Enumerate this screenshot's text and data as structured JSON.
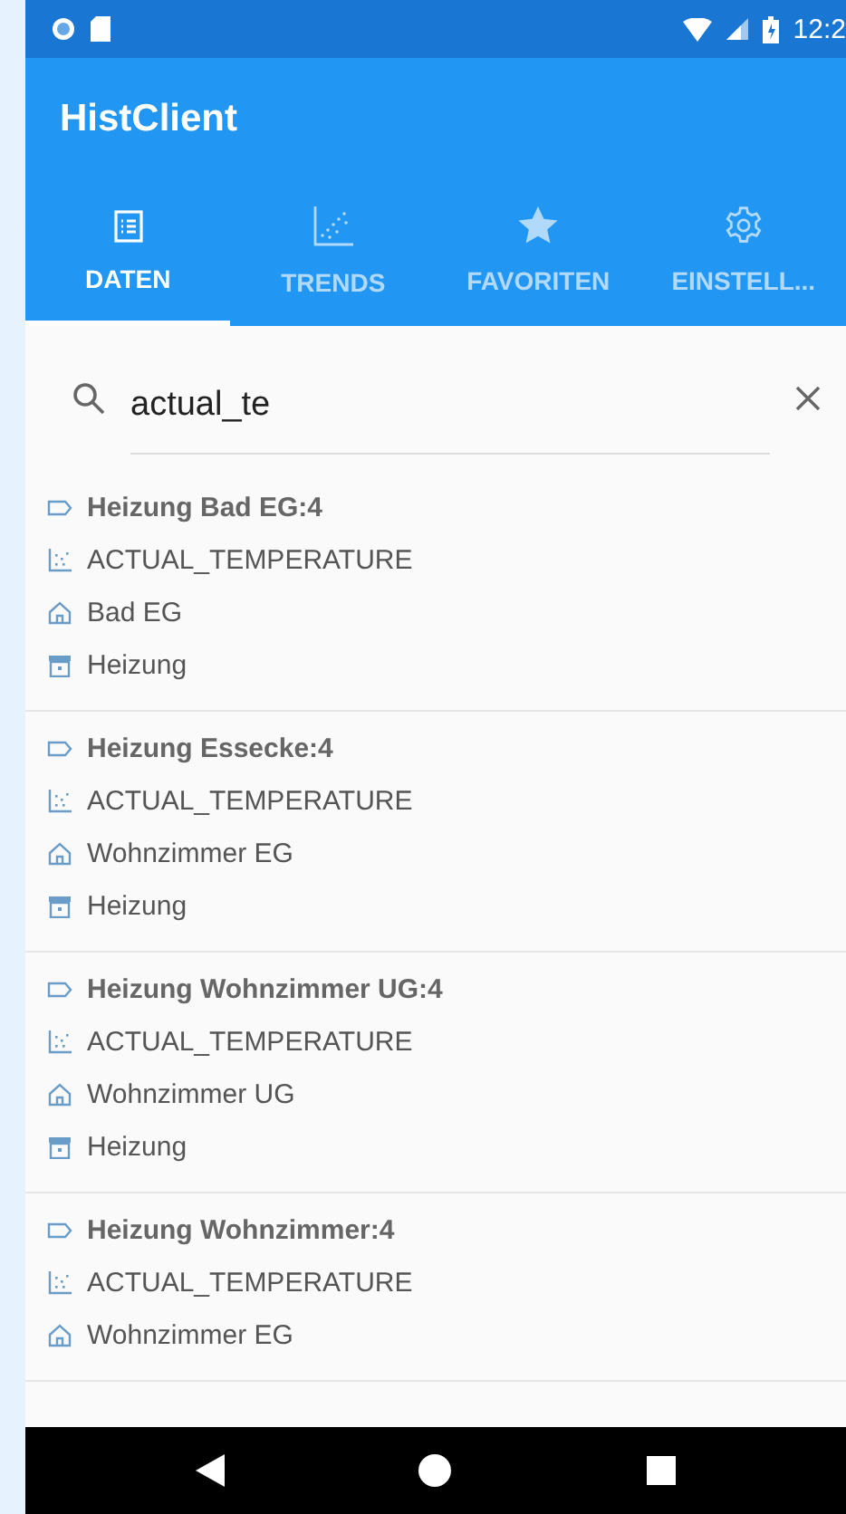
{
  "status_bar": {
    "time": "12:2"
  },
  "app_bar": {
    "title": "HistClient"
  },
  "tabs": [
    {
      "label": "DATEN",
      "kind": "list",
      "selected": true
    },
    {
      "label": "TRENDS",
      "kind": "chart",
      "selected": false
    },
    {
      "label": "FAVORITEN",
      "kind": "star",
      "selected": false
    },
    {
      "label": "EINSTELL...",
      "kind": "gear",
      "selected": false
    }
  ],
  "search": {
    "value": "actual_te"
  },
  "results": [
    {
      "device": "Heizung Bad EG:4",
      "datapoint": "ACTUAL_TEMPERATURE",
      "room": "Bad EG",
      "category": "Heizung"
    },
    {
      "device": "Heizung Essecke:4",
      "datapoint": "ACTUAL_TEMPERATURE",
      "room": "Wohnzimmer EG",
      "category": "Heizung"
    },
    {
      "device": "Heizung Wohnzimmer UG:4",
      "datapoint": "ACTUAL_TEMPERATURE",
      "room": "Wohnzimmer UG",
      "category": "Heizung"
    },
    {
      "device": "Heizung Wohnzimmer:4",
      "datapoint": "ACTUAL_TEMPERATURE",
      "room": "Wohnzimmer EG"
    }
  ]
}
